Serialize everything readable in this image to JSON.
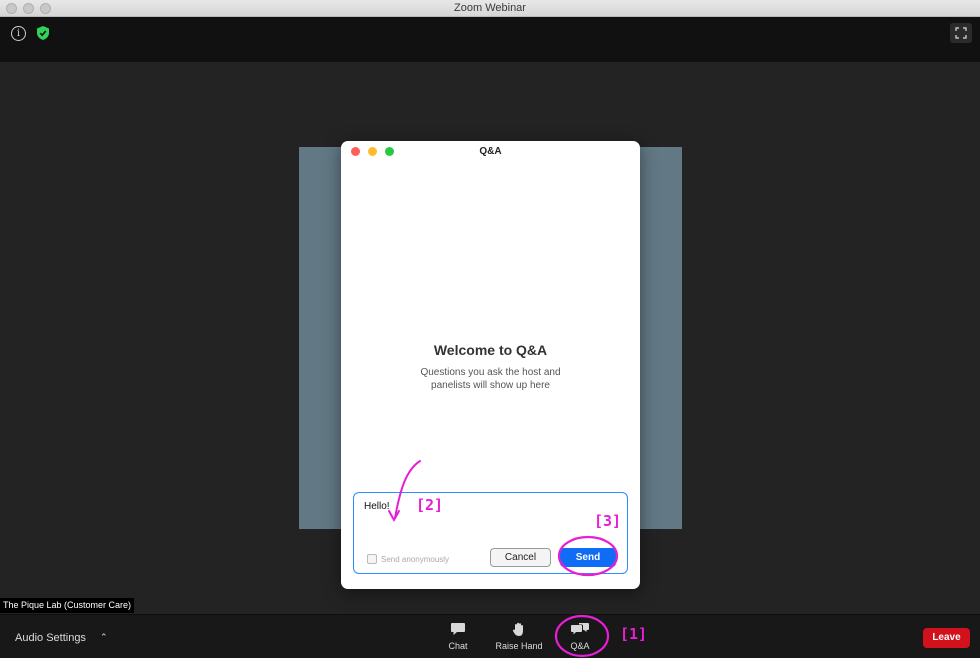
{
  "window": {
    "title": "Zoom Webinar"
  },
  "qa_window": {
    "title": "Q&A",
    "welcome_heading": "Welcome to Q&A",
    "welcome_line1": "Questions you ask the host and",
    "welcome_line2": "panelists will show up here",
    "compose_text": "Hello!",
    "anonymous_label": "Send anonymously",
    "cancel_label": "Cancel",
    "send_label": "Send"
  },
  "participant_name": "The Pique Lab (Customer Care)",
  "toolbar": {
    "audio_settings": "Audio Settings",
    "chat": "Chat",
    "raise_hand": "Raise Hand",
    "qa": "Q&A",
    "leave": "Leave"
  },
  "annotations": {
    "one": "[1]",
    "two": "[2]",
    "three": "[3]"
  },
  "colors": {
    "accent_blue": "#0e6cf5",
    "leave_red": "#d1121d",
    "annotation_magenta": "#e61ed6",
    "shield_green": "#2fd35a"
  },
  "icons": [
    "info-icon",
    "shield-icon",
    "fullscreen-icon",
    "chat-icon",
    "raise-hand-icon",
    "qa-icon",
    "caret-up-icon"
  ]
}
